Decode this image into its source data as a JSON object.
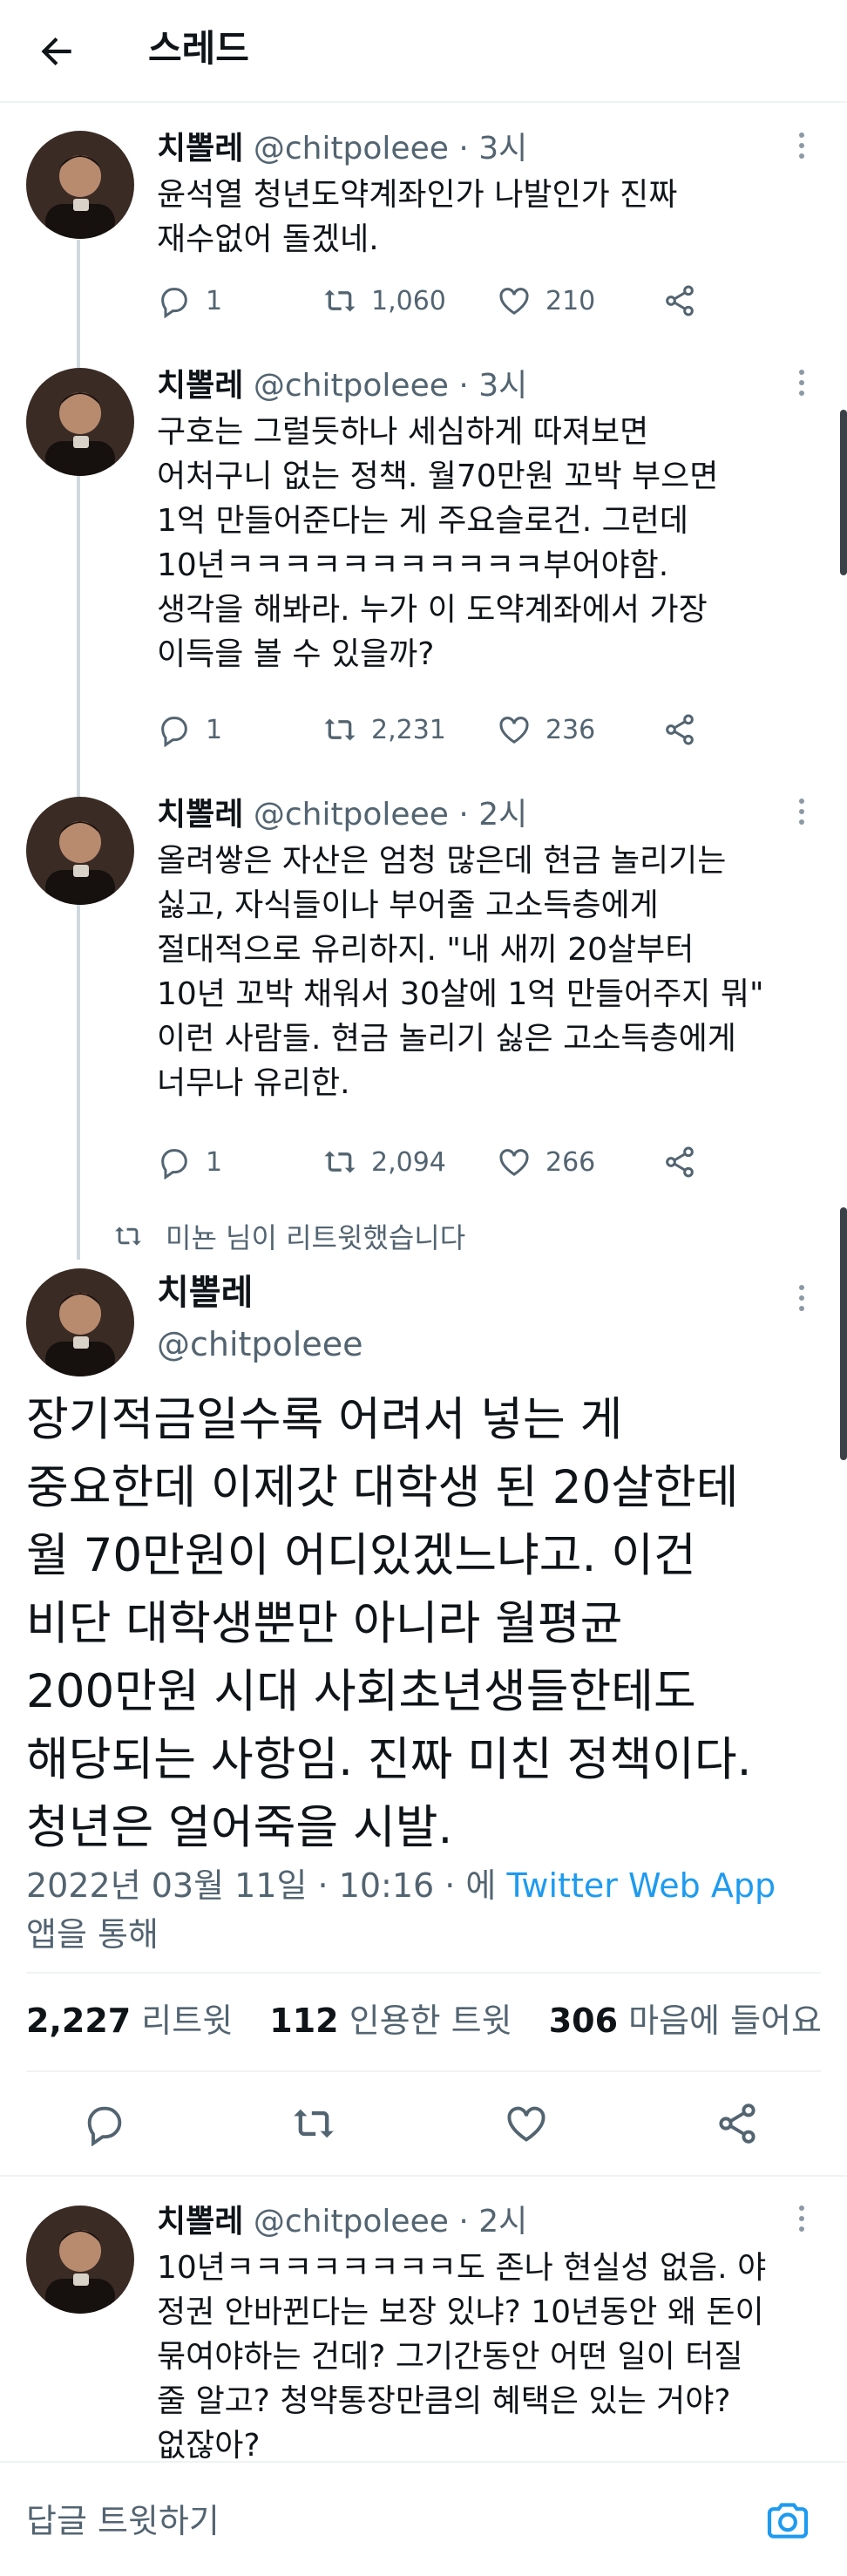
{
  "header": {
    "title": "스레드"
  },
  "tweets": [
    {
      "name": "치뽈레",
      "handle": "@chitpoleee",
      "time": "· 3시",
      "text": "윤석열 청년도약계좌인가 나발인가 진짜\n재수없어 돌겠네.",
      "replies": "1",
      "retweets": "1,060",
      "likes": "210"
    },
    {
      "name": "치뽈레",
      "handle": "@chitpoleee",
      "time": "· 3시",
      "text": "구호는 그럴듯하나 세심하게 따져보면\n어처구니 없는 정책. 월70만원 꼬박 부으면\n1억 만들어준다는 게 주요슬로건. 그런데\n10년ㅋㅋㅋㅋㅋㅋㅋㅋㅋㅋㅋ부어야함.\n생각을 해봐라. 누가 이 도약계좌에서 가장\n이득을 볼 수 있을까?",
      "replies": "1",
      "retweets": "2,231",
      "likes": "236"
    },
    {
      "name": "치뽈레",
      "handle": "@chitpoleee",
      "time": "· 2시",
      "text": "올려쌓은 자산은 엄청 많은데 현금 놀리기는\n싫고, 자식들이나 부어줄 고소득층에게\n절대적으로 유리하지. \"내 새끼 20살부터\n10년 꼬박 채워서 30살에 1억 만들어주지 뭐\"\n이런 사람들. 현금 놀리기 싫은 고소득층에게\n너무나 유리한.",
      "replies": "1",
      "retweets": "2,094",
      "likes": "266"
    }
  ],
  "retweet_note": "미뇬 님이 리트윗했습니다",
  "main_tweet": {
    "name": "치뽈레",
    "handle": "@chitpoleee",
    "text": "장기적금일수록 어려서 넣는 게\n중요한데 이제갓 대학생 된 20살한테\n월 70만원이 어디있겠느냐고. 이건\n비단 대학생뿐만 아니라 월평균\n200만원 시대 사회초년생들한테도\n해당되는 사항임. 진짜 미친 정책이다.\n청년은 얼어죽을 시발.",
    "date": "2022년 03월 11일 · 10:16 · 에",
    "app": "Twitter Web App",
    "via": "앱을 통해",
    "retweets_count": "2,227",
    "retweets_label": "리트윗",
    "quotes_count": "112",
    "quotes_label": "인용한 트윗",
    "likes_count": "306",
    "likes_label": "마음에 들어요"
  },
  "reply_tweet": {
    "name": "치뽈레",
    "handle": "@chitpoleee",
    "time": "· 2시",
    "text": "10년ㅋㅋㅋㅋㅋㅋㅋㅋ도 존나 현실성 없음. 야\n정권 안바뀐다는 보장 있냐? 10년동안 왜 돈이\n묶여야하는 건데? 그기간동안 어떤 일이 터질\n줄 알고? 청약통장만큼의 혜택은 있는 거야?\n없잖아?"
  },
  "reply_bar": {
    "placeholder": "답글 트윗하기"
  },
  "colors": {
    "accent": "#1d9bf0",
    "muted": "#536471",
    "text": "#0f1419"
  },
  "icons": [
    "back-arrow-icon",
    "reply-icon",
    "retweet-icon",
    "like-icon",
    "share-icon",
    "more-icon",
    "camera-icon"
  ]
}
